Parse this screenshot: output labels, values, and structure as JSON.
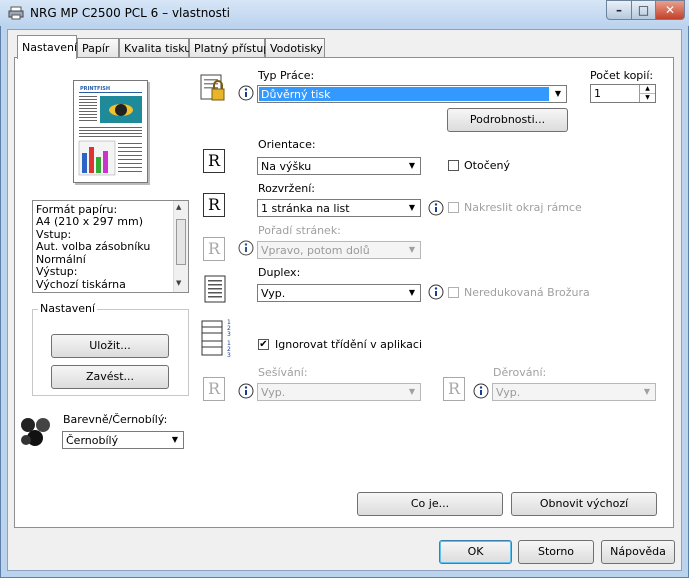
{
  "window": {
    "title": "NRG MP C2500 PCL 6 – vlastnosti",
    "caption_minimize": "–",
    "caption_maximize": "□",
    "caption_close": "✕"
  },
  "tabs": [
    {
      "label": "Nastavení",
      "active": true
    },
    {
      "label": "Papír"
    },
    {
      "label": "Kvalita tisku"
    },
    {
      "label": "Platný přístup"
    },
    {
      "label": "Vodotisky"
    }
  ],
  "job_type": {
    "label": "Typ Práce:",
    "value": "Důvěrný tisk",
    "details_button": "Podrobnosti..."
  },
  "copies": {
    "label": "Počet kopií:",
    "value": "1"
  },
  "orientation": {
    "label": "Orientace:",
    "value": "Na výšku",
    "rotated_label": "Otočený"
  },
  "layout": {
    "label": "Rozvržení:",
    "value": "1 stránka na list",
    "draw_frame_label": "Nakreslit okraj rámce"
  },
  "page_order": {
    "label": "Pořadí stránek:",
    "value": "Vpravo, potom dolů"
  },
  "duplex": {
    "label": "Duplex:",
    "value": "Vyp.",
    "booklet_label": "Neredukovaná Brožura"
  },
  "collate": {
    "label": "Ignorovat třídění v aplikaci",
    "checked": true
  },
  "stapling": {
    "label": "Sešívání:",
    "value": "Vyp."
  },
  "punch": {
    "label": "Děrování:",
    "value": "Vyp."
  },
  "status_list": {
    "rows": [
      "Formát papíru:",
      " A4 (210 x 297 mm)",
      "Vstup:",
      " Aut. volba zásobníku",
      " Normální",
      "Výstup:",
      " Výchozí tiskárna"
    ]
  },
  "settings_group": {
    "legend": "Nastavení",
    "save_button": "Uložit...",
    "load_button": "Zavést..."
  },
  "color_mode": {
    "label": "Barevně/Černobílý:",
    "value": "Černobílý"
  },
  "buttons": {
    "whats_this": "Co je...",
    "restore_defaults": "Obnovit výchozí",
    "ok": "OK",
    "cancel": "Storno",
    "help": "Nápověda"
  },
  "preview": {
    "masthead": "PRINTFISH"
  },
  "glyphs": {
    "dropdown_arrow": "▼",
    "spin_up": "▲",
    "spin_down": "▼",
    "check": "✔",
    "r": "R"
  },
  "colors": {
    "selection": "#3399ff",
    "window_frame": "#bcd3ee",
    "close_button": "#c4412a"
  }
}
